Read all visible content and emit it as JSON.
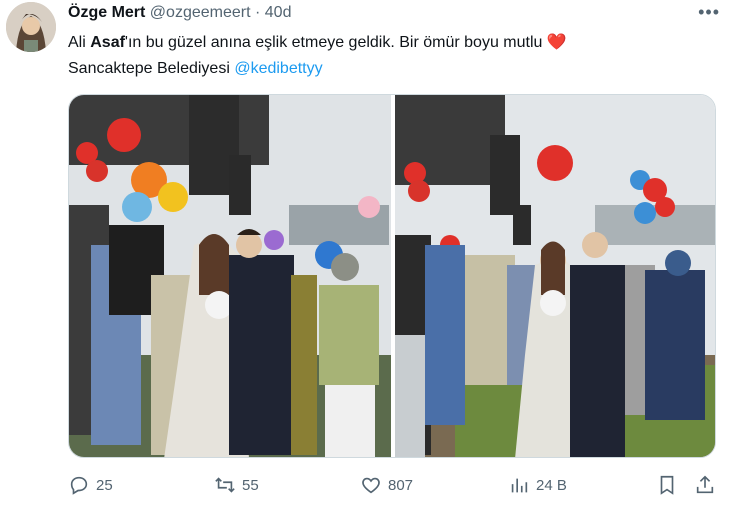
{
  "author": {
    "name": "Özge Mert",
    "handle": "@ozgeemeert",
    "separator": "·",
    "time": "40d"
  },
  "more_label": "•••",
  "tweet": {
    "part1": "Ali ",
    "bold": "Asaf",
    "part2": "'ın bu güzel anına eşlik etmeye geldik. Bir ömür boyu mutlu ",
    "heart": "❤️",
    "line2": "Sancaktepe Belediyesi ",
    "mention": "@kedibettyy"
  },
  "stats": {
    "replies": "25",
    "retweets": "55",
    "likes": "807",
    "views": "24 B"
  },
  "colors": {
    "text": "#0f1419",
    "secondary": "#536471",
    "link": "#1d9bf0",
    "heart": "#e0245e"
  }
}
